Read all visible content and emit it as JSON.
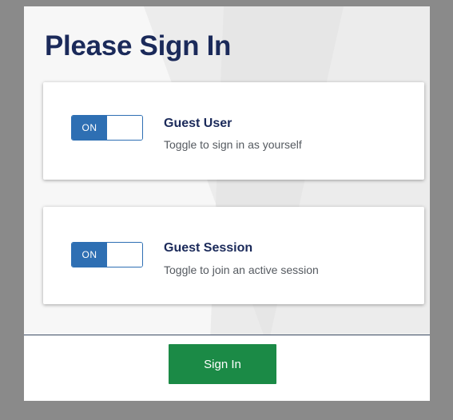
{
  "page": {
    "title": "Please Sign In"
  },
  "options": [
    {
      "toggle_label": "ON",
      "title": "Guest User",
      "description": "Toggle to sign in as yourself",
      "enabled": true
    },
    {
      "toggle_label": "ON",
      "title": "Guest Session",
      "description": "Toggle to join an active session",
      "enabled": true
    }
  ],
  "footer": {
    "sign_in_label": "Sign In"
  },
  "colors": {
    "heading": "#1b2a5a",
    "toggle_accent": "#2e6fb3",
    "primary_button": "#1b8a46"
  }
}
